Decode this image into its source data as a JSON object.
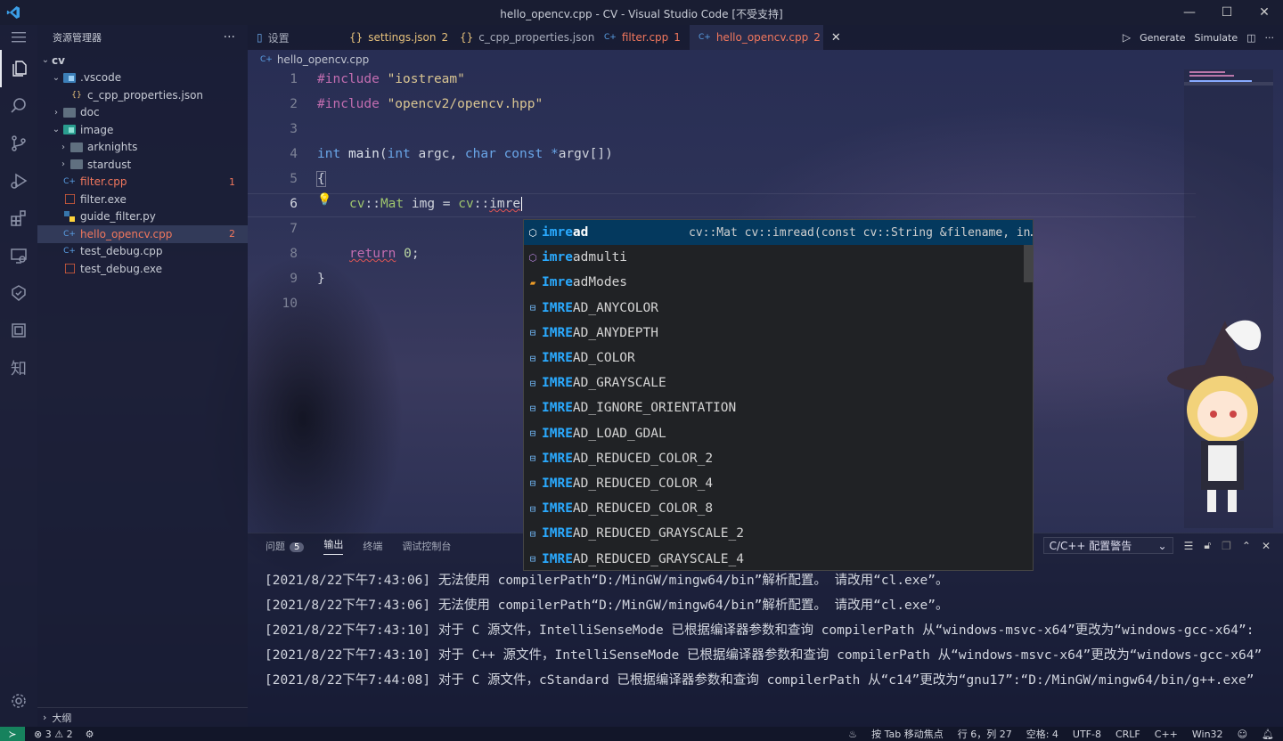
{
  "window": {
    "title": "hello_opencv.cpp - CV - Visual Studio Code [不受支持]"
  },
  "sidebar": {
    "title": "资源管理器",
    "more": "···",
    "root": "cv",
    "items": [
      {
        "label": "cv",
        "badge": ""
      },
      {
        "label": ".vscode",
        "badge": ""
      },
      {
        "label": "c_cpp_properties.json",
        "badge": ""
      },
      {
        "label": "doc",
        "badge": ""
      },
      {
        "label": "image",
        "badge": ""
      },
      {
        "label": "arknights",
        "badge": ""
      },
      {
        "label": "stardust",
        "badge": ""
      },
      {
        "label": "filter.cpp",
        "badge": "1"
      },
      {
        "label": "filter.exe",
        "badge": ""
      },
      {
        "label": "guide_filter.py",
        "badge": ""
      },
      {
        "label": "hello_opencv.cpp",
        "badge": "2"
      },
      {
        "label": "test_debug.cpp",
        "badge": ""
      },
      {
        "label": "test_debug.exe",
        "badge": ""
      }
    ],
    "outline": "大纲"
  },
  "tabs": [
    {
      "label": "设置",
      "badge": ""
    },
    {
      "label": "settings.json",
      "badge": "2"
    },
    {
      "label": "c_cpp_properties.json",
      "badge": ""
    },
    {
      "label": "filter.cpp",
      "badge": "1"
    },
    {
      "label": "hello_opencv.cpp",
      "badge": "2"
    }
  ],
  "tab_actions": {
    "generate": "Generate",
    "simulate": "Simulate"
  },
  "breadcrumb": "hello_opencv.cpp",
  "editor": {
    "line_numbers": [
      "1",
      "2",
      "3",
      "4",
      "5",
      "6",
      "7",
      "8",
      "9",
      "10"
    ],
    "cursor": "行 6，列 27"
  },
  "suggestions": [
    {
      "match": "imre",
      "rest": "ad",
      "kind": "function",
      "detail": "cv::Mat cv::imread(const cv::String &filename, in…"
    },
    {
      "match": "imre",
      "rest": "admulti",
      "kind": "function",
      "detail": ""
    },
    {
      "match": "Imre",
      "rest": "adModes",
      "kind": "enum",
      "detail": ""
    },
    {
      "match": "IMRE",
      "rest": "AD_ANYCOLOR",
      "kind": "constant",
      "detail": ""
    },
    {
      "match": "IMRE",
      "rest": "AD_ANYDEPTH",
      "kind": "constant",
      "detail": ""
    },
    {
      "match": "IMRE",
      "rest": "AD_COLOR",
      "kind": "constant",
      "detail": ""
    },
    {
      "match": "IMRE",
      "rest": "AD_GRAYSCALE",
      "kind": "constant",
      "detail": ""
    },
    {
      "match": "IMRE",
      "rest": "AD_IGNORE_ORIENTATION",
      "kind": "constant",
      "detail": ""
    },
    {
      "match": "IMRE",
      "rest": "AD_LOAD_GDAL",
      "kind": "constant",
      "detail": ""
    },
    {
      "match": "IMRE",
      "rest": "AD_REDUCED_COLOR_2",
      "kind": "constant",
      "detail": ""
    },
    {
      "match": "IMRE",
      "rest": "AD_REDUCED_COLOR_4",
      "kind": "constant",
      "detail": ""
    },
    {
      "match": "IMRE",
      "rest": "AD_REDUCED_COLOR_8",
      "kind": "constant",
      "detail": ""
    },
    {
      "match": "IMRE",
      "rest": "AD_REDUCED_GRAYSCALE_2",
      "kind": "constant",
      "detail": ""
    },
    {
      "match": "IMRE",
      "rest": "AD_REDUCED_GRAYSCALE_4",
      "kind": "constant",
      "detail": ""
    }
  ],
  "panel": {
    "tabs": [
      "问题",
      "输出",
      "终端",
      "调试控制台"
    ],
    "problems_count": "5",
    "channel": "C/C++ 配置警告",
    "lines": [
      "[2021/8/22下午7:43:06] 无法使用 compilerPath“D:/MinGW/mingw64/bin”解析配置。 请改用“cl.exe”。",
      "[2021/8/22下午7:43:06] 无法使用 compilerPath“D:/MinGW/mingw64/bin”解析配置。 请改用“cl.exe”。",
      "[2021/8/22下午7:43:10] 对于 C 源文件，IntelliSenseMode 已根据编译器参数和查询 compilerPath 从“windows-msvc-x64”更改为“windows-gcc-x64”:",
      "[2021/8/22下午7:43:10] 对于 C++ 源文件，IntelliSenseMode 已根据编译器参数和查询 compilerPath 从“windows-msvc-x64”更改为“windows-gcc-x64”",
      "[2021/8/22下午7:44:08] 对于 C 源文件，cStandard 已根据编译器参数和查询 compilerPath 从“c14”更改为“gnu17”:“D:/MinGW/mingw64/bin/g++.exe”"
    ]
  },
  "statusbar": {
    "errors": "3",
    "warnings": "2",
    "focus": "按 Tab 移动焦点",
    "position": "行 6，列 27",
    "spaces": "空格: 4",
    "encoding": "UTF-8",
    "eol": "CRLF",
    "language": "C++",
    "platform": "Win32"
  },
  "colors": {
    "accent": "#007acc",
    "error": "#f1775d",
    "match": "#2aaaff",
    "selection": "#04395e"
  }
}
